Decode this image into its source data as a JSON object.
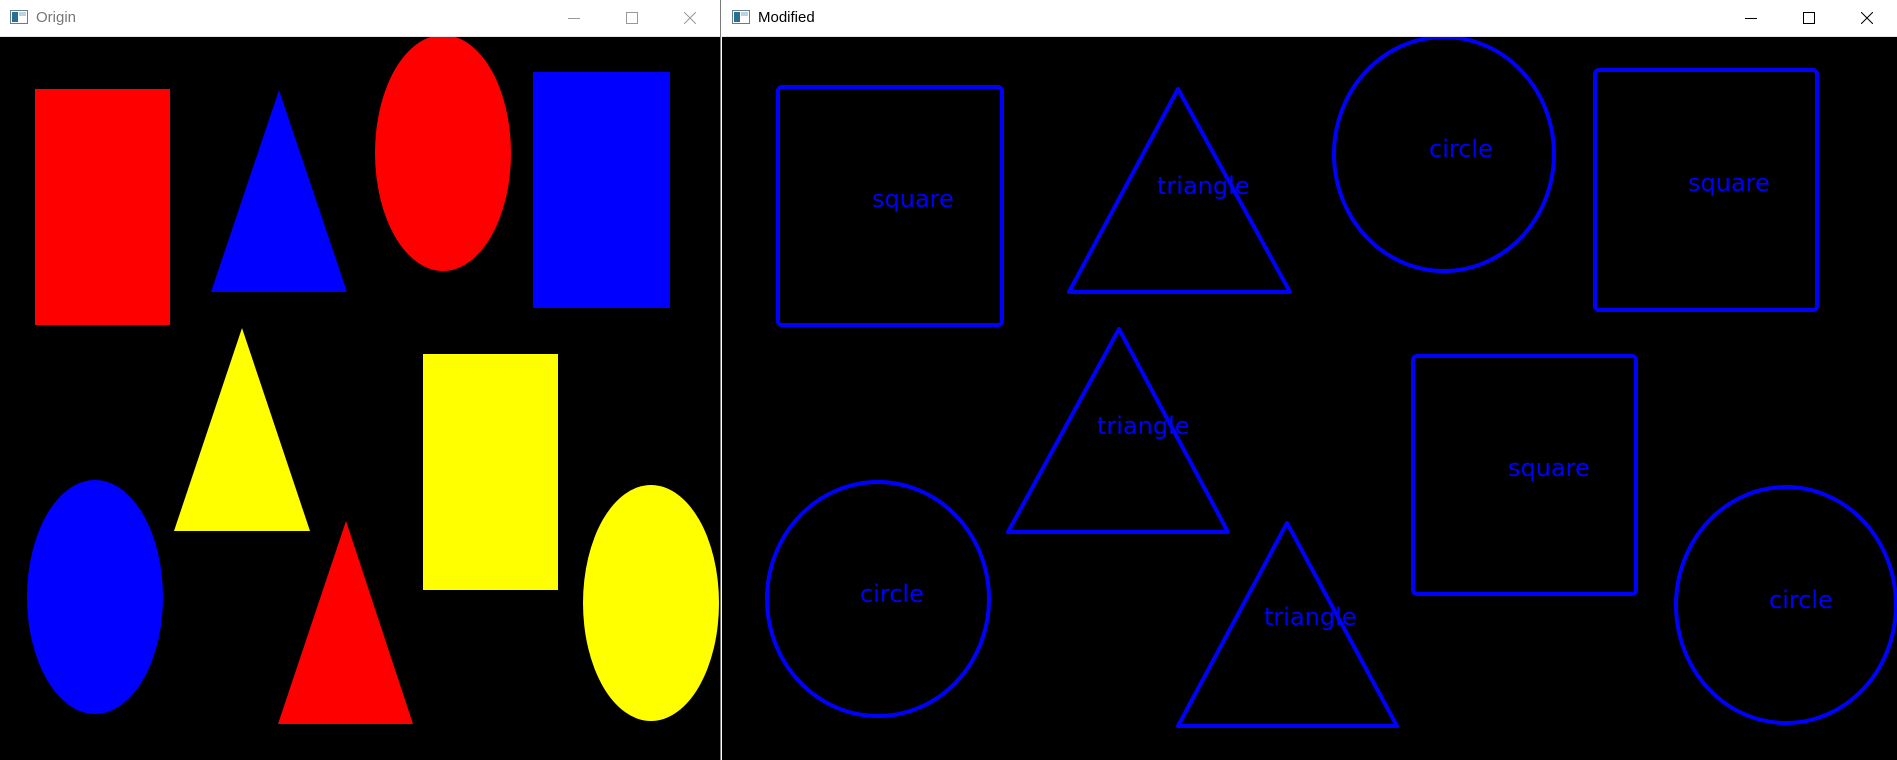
{
  "windows": {
    "origin": {
      "title": "Origin"
    },
    "modified": {
      "title": "Modified"
    }
  },
  "colors": {
    "red": "#ff0000",
    "blue": "#0000ff",
    "yellow": "#ffff00",
    "background": "#000000",
    "contour": "#0000ff"
  },
  "labels": {
    "square": "square",
    "triangle": "triangle",
    "circle": "circle"
  },
  "icons": [
    "app-icon",
    "minimize-icon",
    "maximize-icon",
    "close-icon"
  ]
}
